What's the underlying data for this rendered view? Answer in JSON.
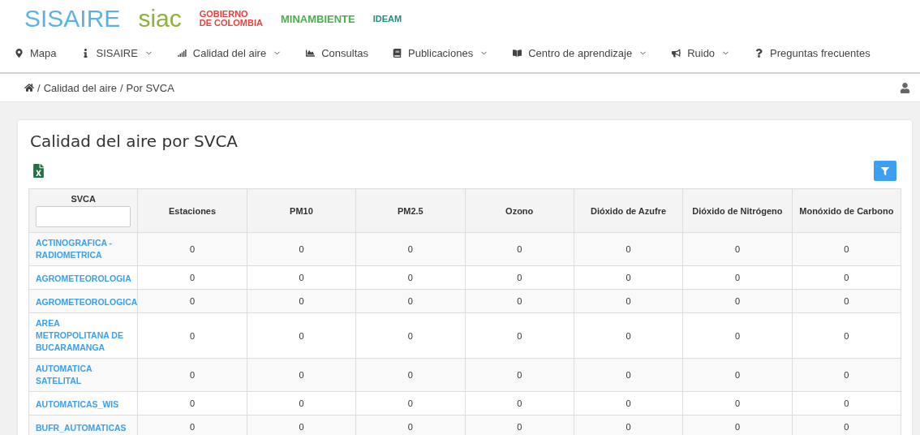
{
  "logos": [
    {
      "kind": "sisaire",
      "text": "SISAIRE"
    },
    {
      "kind": "siac",
      "text": "siac"
    },
    {
      "kind": "gov",
      "text": "GOBIERNO\nDE COLOMBIA"
    },
    {
      "kind": "minamb",
      "text": "MINAMBIENTE"
    },
    {
      "kind": "ideam",
      "text": "IDEAM"
    }
  ],
  "nav": [
    {
      "label": "Mapa",
      "dropdown": false
    },
    {
      "label": "SISAIRE",
      "dropdown": true
    },
    {
      "label": "Calidad del aire",
      "dropdown": true
    },
    {
      "label": "Consultas",
      "dropdown": false
    },
    {
      "label": "Publicaciones",
      "dropdown": true
    },
    {
      "label": "Centro de aprendizaje",
      "dropdown": true
    },
    {
      "label": "Ruido",
      "dropdown": true
    },
    {
      "label": "Preguntas frecuentes",
      "dropdown": false
    }
  ],
  "breadcrumb": {
    "separator": "/",
    "items": [
      "Calidad del aire",
      "Por SVCA"
    ]
  },
  "card": {
    "title": "Calidad del aire por SVCA"
  },
  "table": {
    "columns": [
      "SVCA",
      "Estaciones",
      "PM10",
      "PM2.5",
      "Ozono",
      "Dióxido de Azufre",
      "Dióxido de Nitrógeno",
      "Monóxido de Carbono"
    ],
    "rows": [
      [
        "ACTINOGRAFICA - RADIOMETRICA",
        "0",
        "0",
        "0",
        "0",
        "0",
        "0",
        "0"
      ],
      [
        "AGROMETEOROLOGIA",
        "0",
        "0",
        "0",
        "0",
        "0",
        "0",
        "0"
      ],
      [
        "AGROMETEOROLOGICA",
        "0",
        "0",
        "0",
        "0",
        "0",
        "0",
        "0"
      ],
      [
        "AREA METROPOLITANA DE BUCARAMANGA",
        "0",
        "0",
        "0",
        "0",
        "0",
        "0",
        "0"
      ],
      [
        "AUTOMATICA SATELITAL",
        "0",
        "0",
        "0",
        "0",
        "0",
        "0",
        "0"
      ],
      [
        "AUTOMATICAS_WIS",
        "0",
        "0",
        "0",
        "0",
        "0",
        "0",
        "0"
      ],
      [
        "BUFR_AUTOMATICAS",
        "0",
        "0",
        "0",
        "0",
        "0",
        "0",
        "0"
      ]
    ]
  }
}
